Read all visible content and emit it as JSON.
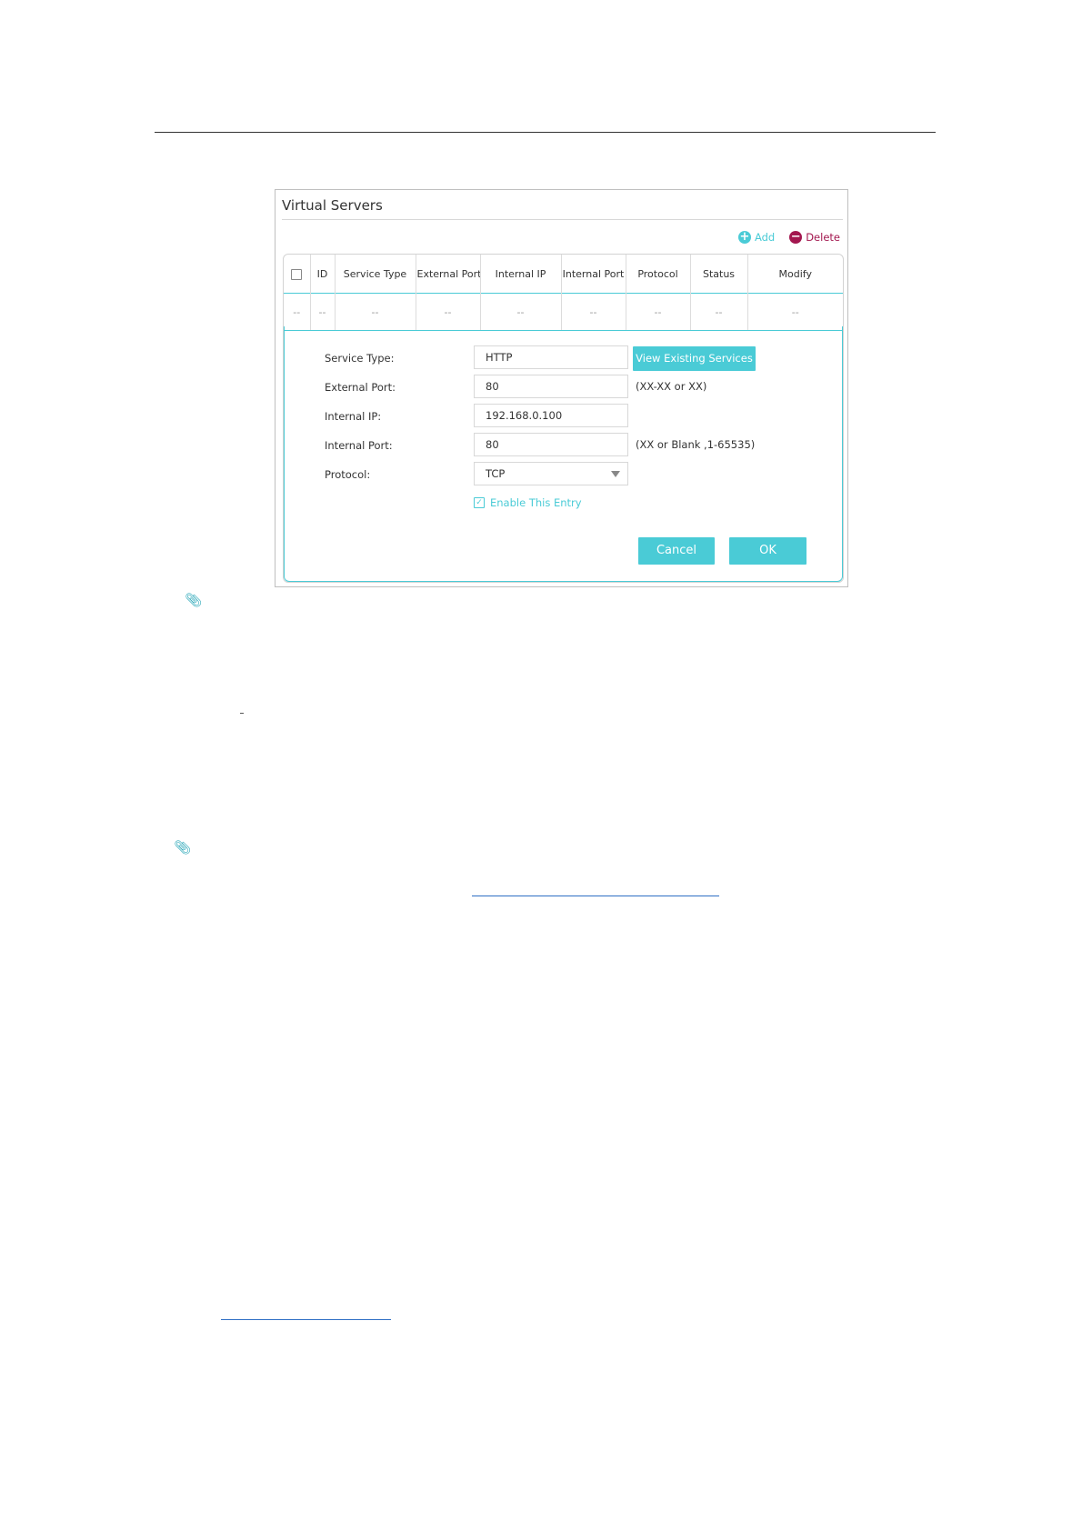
{
  "panel": {
    "title": "Virtual Servers",
    "add_label": "Add",
    "delete_label": "Delete",
    "icons": {
      "add": "plus-circle-icon",
      "delete": "minus-circle-icon",
      "note": "paperclip-icon"
    },
    "accent_color": "#4acbd6",
    "delete_color": "#a3174f"
  },
  "table": {
    "columns": [
      "ID",
      "Service Type",
      "External Port",
      "Internal IP",
      "Internal Port",
      "Protocol",
      "Status",
      "Modify"
    ],
    "row": [
      "--",
      "--",
      "--",
      "--",
      "--",
      "--",
      "--",
      "--",
      "--"
    ]
  },
  "form": {
    "service_type_label": "Service Type:",
    "service_type_value": "HTTP",
    "view_services_label": "View Existing Services",
    "external_port_label": "External Port:",
    "external_port_value": "80",
    "external_port_hint": "(XX-XX or XX)",
    "internal_ip_label": "Internal IP:",
    "internal_ip_value": "192.168.0.100",
    "internal_port_label": "Internal Port:",
    "internal_port_value": "80",
    "internal_port_hint": "(XX or Blank ,1-65535)",
    "protocol_label": "Protocol:",
    "protocol_value": "TCP",
    "enable_label": "Enable This Entry",
    "cancel_label": "Cancel",
    "ok_label": "OK"
  }
}
